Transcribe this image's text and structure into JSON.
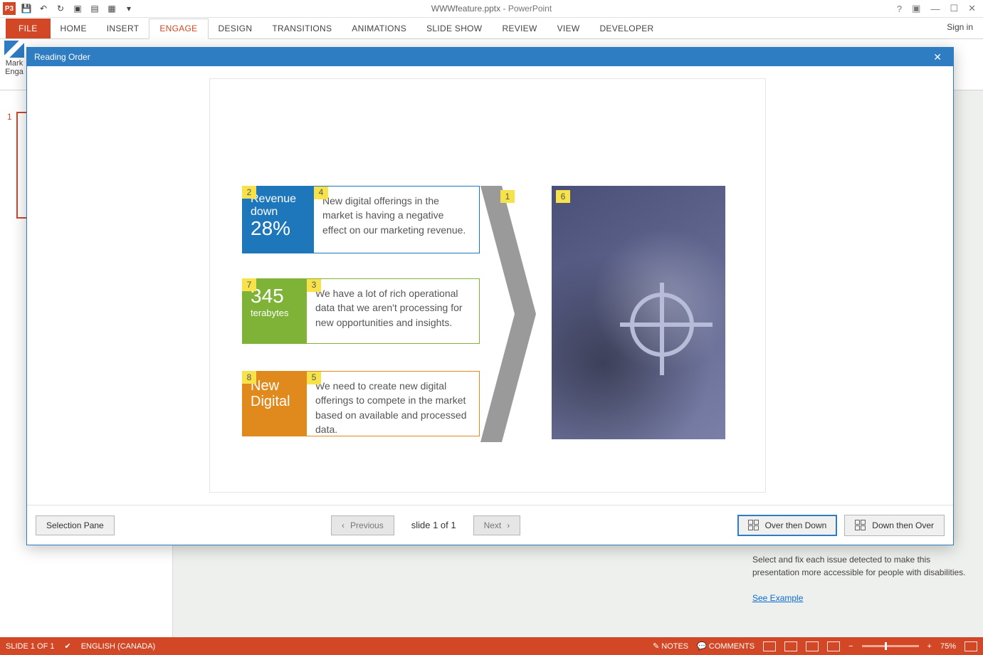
{
  "titlebar": {
    "doc": "WWWfeature.pptx",
    "app": "PowerPoint"
  },
  "tabs": {
    "file": "FILE",
    "home": "HOME",
    "insert": "INSERT",
    "engage": "ENGAGE",
    "design": "DESIGN",
    "transitions": "TRANSITIONS",
    "animations": "ANIMATIONS",
    "slideshow": "SLIDE SHOW",
    "review": "REVIEW",
    "view": "VIEW",
    "developer": "DEVELOPER",
    "signin": "Sign in"
  },
  "ribbon": {
    "markengage_line1": "Mark",
    "markengage_line2": "Enga"
  },
  "thumb": {
    "num": "1"
  },
  "dialog": {
    "title": "Reading Order",
    "selection_pane": "Selection Pane",
    "previous": "Previous",
    "next": "Next",
    "slide_pos": "slide 1 of 1",
    "over_then_down": "Over then Down",
    "down_then_over": "Down then Over"
  },
  "slide": {
    "order": {
      "arrow": "1",
      "tile1": "2",
      "desc2": "3",
      "desc1": "4",
      "desc3": "5",
      "image": "6",
      "tile2": "7",
      "tile3": "8"
    },
    "tile1": {
      "head": "Revenue down",
      "big": "28%"
    },
    "desc1": "New digital offerings in the market is having a negative effect on our marketing revenue.",
    "tile2": {
      "big": "345",
      "sub": "terabytes"
    },
    "desc2": "We have a lot of rich operational data that we aren't processing for new opportunities and insights.",
    "tile3": {
      "head": "New Digital"
    },
    "desc3": "We need to create new digital offerings to compete in the market based on available and processed data."
  },
  "accessibility": {
    "text": "Select and fix each issue detected to make this presentation more accessible for people with disabilities.",
    "link": "See Example"
  },
  "status": {
    "slide": "SLIDE 1 OF 1",
    "lang": "ENGLISH (CANADA)",
    "notes": "NOTES",
    "comments": "COMMENTS",
    "zoom": "75%"
  }
}
